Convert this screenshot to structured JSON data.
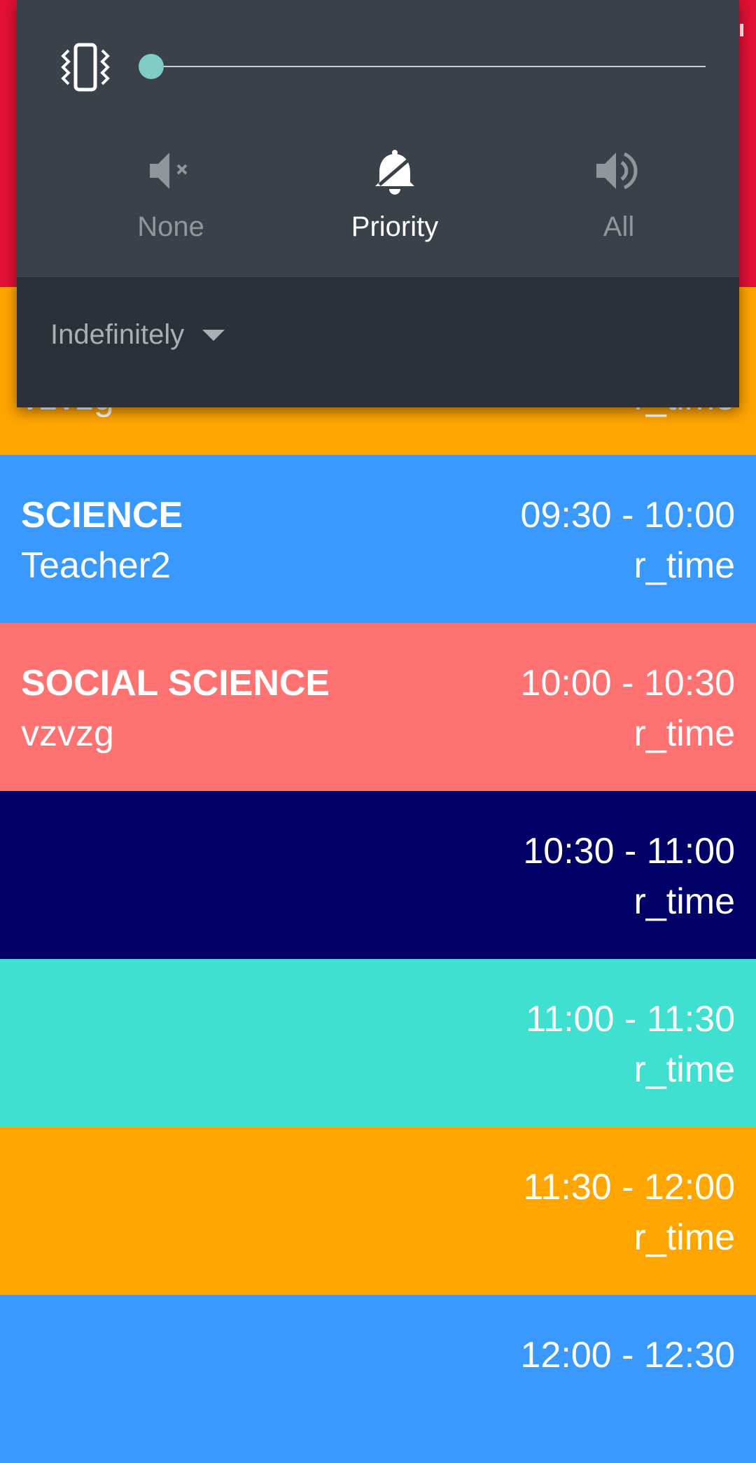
{
  "dnd_panel": {
    "volume_level": 0,
    "modes": [
      {
        "label": "None",
        "icon": "volume-off-icon",
        "active": false
      },
      {
        "label": "Priority",
        "icon": "priority-bell-icon",
        "active": true
      },
      {
        "label": "All",
        "icon": "volume-up-icon",
        "active": false
      }
    ],
    "duration_label": "Indefinitely"
  },
  "schedule": {
    "rows": [
      {
        "subject": "",
        "teacher": "vzvzg",
        "time": "",
        "rtime": "r_time",
        "color": "#ffa500"
      },
      {
        "subject": "SCIENCE",
        "teacher": "Teacher2",
        "time": "09:30 - 10:00",
        "rtime": "r_time",
        "color": "#3a99ff"
      },
      {
        "subject": "SOCIAL SCIENCE",
        "teacher": "vzvzg",
        "time": "10:00 - 10:30",
        "rtime": "r_time",
        "color": "#ff7272"
      },
      {
        "subject": "",
        "teacher": "",
        "time": "10:30 - 11:00",
        "rtime": "r_time",
        "color": "#000066"
      },
      {
        "subject": "",
        "teacher": "",
        "time": "11:00 - 11:30",
        "rtime": "r_time",
        "color": "#40e0d0"
      },
      {
        "subject": "",
        "teacher": "",
        "time": "11:30 - 12:00",
        "rtime": "r_time",
        "color": "#ffa500"
      },
      {
        "subject": "",
        "teacher": "",
        "time": "12:00 - 12:30",
        "rtime": "",
        "color": "#3a99ff"
      }
    ]
  },
  "colors": {
    "header": "#e21034",
    "panel_top": "#3a4148",
    "panel_bottom": "#2a3138",
    "accent": "#80cbc4"
  }
}
